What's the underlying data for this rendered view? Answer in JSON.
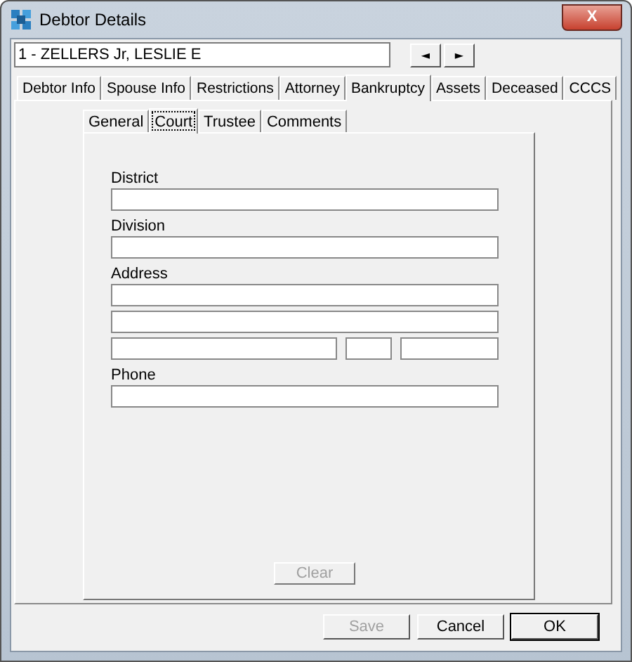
{
  "window": {
    "title": "Debtor Details",
    "close_label": "X"
  },
  "debtor_selector": {
    "value": "1 - ZELLERS Jr, LESLIE E",
    "prev_label": "◄",
    "next_label": "►"
  },
  "tabs": [
    {
      "label": "Debtor Info",
      "selected": false
    },
    {
      "label": "Spouse Info",
      "selected": false
    },
    {
      "label": "Restrictions",
      "selected": false
    },
    {
      "label": "Attorney",
      "selected": false
    },
    {
      "label": "Bankruptcy",
      "selected": true
    },
    {
      "label": "Assets",
      "selected": false
    },
    {
      "label": "Deceased",
      "selected": false
    },
    {
      "label": "CCCS",
      "selected": false
    }
  ],
  "sub_tabs": [
    {
      "label": "General",
      "selected": false,
      "focused": false
    },
    {
      "label": "Court",
      "selected": true,
      "focused": true
    },
    {
      "label": "Trustee",
      "selected": false,
      "focused": false
    },
    {
      "label": "Comments",
      "selected": false,
      "focused": false
    }
  ],
  "court_form": {
    "sections": [
      {
        "label": "District",
        "lines": [
          {
            "kind": "full"
          }
        ]
      },
      {
        "label": "Division",
        "lines": [
          {
            "kind": "full"
          }
        ]
      },
      {
        "label": "Address",
        "lines": [
          {
            "kind": "full"
          },
          {
            "kind": "full"
          },
          {
            "kind": "city_state_zip"
          }
        ]
      },
      {
        "label": "Phone",
        "lines": [
          {
            "kind": "full"
          }
        ]
      }
    ],
    "clear_button": {
      "label": "Clear",
      "disabled": true
    }
  },
  "buttons": [
    {
      "label": "Save",
      "disabled": true,
      "default": false
    },
    {
      "label": "Cancel",
      "disabled": false,
      "default": false
    },
    {
      "label": "OK",
      "disabled": false,
      "default": true
    }
  ]
}
